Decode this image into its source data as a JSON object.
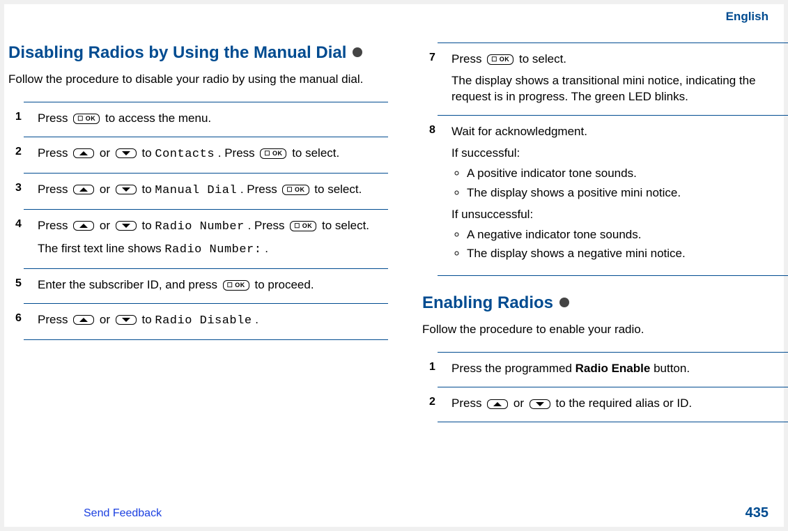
{
  "lang": "English",
  "section1": {
    "title": "Disabling Radios by Using the Manual Dial",
    "intro": "Follow the procedure to disable your radio by using the manual dial.",
    "steps": {
      "s1_a": "Press ",
      "s1_b": " to access the menu.",
      "s2_a": "Press ",
      "s2_b": " or ",
      "s2_c": " to ",
      "s2_menu": "Contacts",
      "s2_d": ". Press ",
      "s2_e": " to select.",
      "s3_a": "Press ",
      "s3_b": " or ",
      "s3_c": " to ",
      "s3_menu": "Manual Dial",
      "s3_d": ". Press ",
      "s3_e": " to select.",
      "s4_a": "Press ",
      "s4_b": " or ",
      "s4_c": " to ",
      "s4_menu": "Radio Number",
      "s4_d": ". Press ",
      "s4_e": " to select.",
      "s4_note_a": "The first text line shows ",
      "s4_note_menu": "Radio Number:",
      "s4_note_b": ".",
      "s5_a": "Enter the subscriber ID, and press ",
      "s5_b": " to proceed.",
      "s6_a": "Press ",
      "s6_b": " or ",
      "s6_c": " to ",
      "s6_menu": "Radio Disable",
      "s6_d": ".",
      "s7_a": "Press ",
      "s7_b": " to select.",
      "s7_note": "The display shows a transitional mini notice, indicating the request is in progress. The green LED blinks.",
      "s8_a": "Wait for acknowledgment.",
      "s8_if1": "If successful:",
      "s8_b1": "A positive indicator tone sounds.",
      "s8_b2": "The display shows a positive mini notice.",
      "s8_if2": "If unsuccessful:",
      "s8_b3": "A negative indicator tone sounds.",
      "s8_b4": "The display shows a negative mini notice."
    }
  },
  "section2": {
    "title": "Enabling Radios",
    "intro": "Follow the procedure to enable your radio.",
    "steps": {
      "s1_a": "Press the programmed ",
      "s1_bold": "Radio Enable",
      "s1_b": " button.",
      "s2_a": "Press ",
      "s2_b": " or ",
      "s2_c": " to the required alias or ID."
    }
  },
  "icons": {
    "ok": "☐ OK"
  },
  "footer": {
    "link": "Send Feedback",
    "page": "435"
  }
}
